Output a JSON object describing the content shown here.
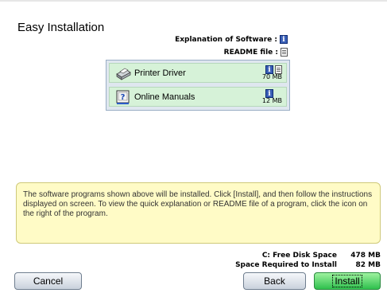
{
  "page": {
    "title": "Easy Installation",
    "legend": {
      "explanation_label": "Explanation of Software :",
      "readme_label": "README file :"
    }
  },
  "software": [
    {
      "name": "Printer Driver",
      "size": "70 MB",
      "icons": [
        "info-icon",
        "readme-icon"
      ]
    },
    {
      "name": "Online Manuals",
      "size": "12 MB",
      "icons": [
        "info-icon"
      ]
    }
  ],
  "note": "The software programs shown above will be installed. Click [Install], and then follow the instructions displayed on screen. To view the quick explanation or README file of a program, click the icon on the right of the program.",
  "disk": {
    "free_label": "C: Free Disk Space",
    "free_value": "478 MB",
    "required_label": "Space Required to Install",
    "required_value": "82 MB"
  },
  "buttons": {
    "cancel": "Cancel",
    "back": "Back",
    "install": "Install"
  },
  "colors": {
    "row_bg": "#d6f2d8",
    "note_bg": "#fffbc6",
    "install_btn": "#2fc04d",
    "info_icon": "#3a5fb6"
  }
}
